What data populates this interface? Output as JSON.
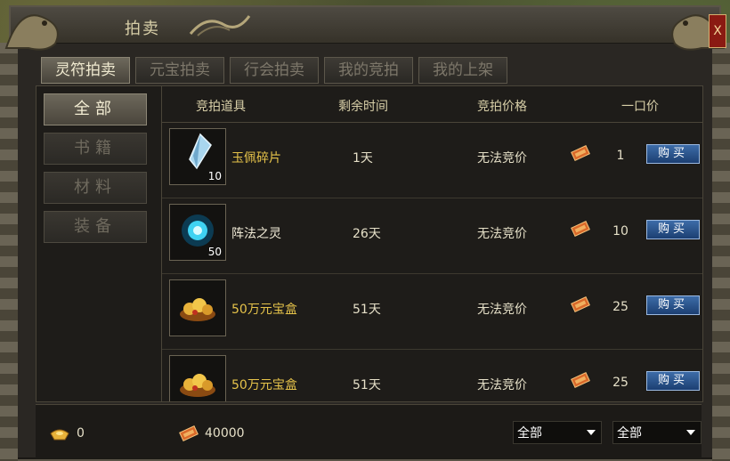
{
  "window": {
    "title": "拍卖",
    "close_label": "X"
  },
  "tabs": [
    {
      "label": "灵符拍卖",
      "active": true
    },
    {
      "label": "元宝拍卖",
      "active": false
    },
    {
      "label": "行会拍卖",
      "active": false
    },
    {
      "label": "我的竞拍",
      "active": false
    },
    {
      "label": "我的上架",
      "active": false
    }
  ],
  "categories": [
    {
      "label": "全部",
      "active": true
    },
    {
      "label": "书籍",
      "active": false
    },
    {
      "label": "材料",
      "active": false
    },
    {
      "label": "装备",
      "active": false
    }
  ],
  "table": {
    "headers": {
      "item": "竞拍道具",
      "time": "剩余时间",
      "bid": "竞拍价格",
      "buyout": "一口价"
    },
    "rows": [
      {
        "icon": "jade-shard-icon",
        "qty": "10",
        "name": "玉佩碎片",
        "name_color": "#e6c34a",
        "time": "1天",
        "bid": "无法竞价",
        "price": "1",
        "buy_label": "购买"
      },
      {
        "icon": "formation-spirit-orb-icon",
        "qty": "50",
        "name": "阵法之灵",
        "name_color": "#f0ead6",
        "time": "26天",
        "bid": "无法竞价",
        "price": "10",
        "buy_label": "购买"
      },
      {
        "icon": "treasure-box-icon",
        "qty": "",
        "name": "50万元宝盒",
        "name_color": "#e6c34a",
        "time": "51天",
        "bid": "无法竞价",
        "price": "25",
        "buy_label": "购买"
      },
      {
        "icon": "treasure-box-icon",
        "qty": "",
        "name": "50万元宝盒",
        "name_color": "#e6c34a",
        "time": "51天",
        "bid": "无法竞价",
        "price": "25",
        "buy_label": "购买"
      }
    ]
  },
  "footer": {
    "ingot_value": "0",
    "talisman_value": "40000",
    "filter1": "全部",
    "filter2": "全部"
  },
  "colors": {
    "highlight": "#e6c34a",
    "button": "#1c3f72"
  }
}
